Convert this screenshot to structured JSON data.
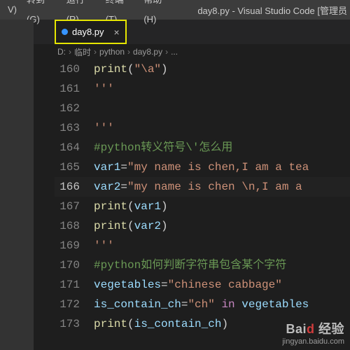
{
  "menu": {
    "items": [
      {
        "label": "V)"
      },
      {
        "label": "转到(G)"
      },
      {
        "label": "运行(R)"
      },
      {
        "label": "终端(T)"
      },
      {
        "label": "帮助(H)"
      }
    ],
    "title": "day8.py - Visual Studio Code [管理员"
  },
  "tab": {
    "dirty_color": "#3794ff",
    "label": "day8.py",
    "close": "×"
  },
  "breadcrumb": {
    "parts": [
      "D:",
      "临时",
      "python",
      "day8.py",
      "..."
    ],
    "chev": "›"
  },
  "dots": "'''",
  "lines": [
    {
      "n": "160",
      "tokens": [
        {
          "t": "fn",
          "v": "print"
        },
        {
          "t": "op",
          "v": "("
        },
        {
          "t": "str",
          "v": "\"\\a\""
        },
        {
          "t": "op",
          "v": ")"
        }
      ]
    },
    {
      "n": "161",
      "tokens": [
        {
          "t": "str",
          "v": "'''"
        }
      ]
    },
    {
      "n": "162",
      "tokens": []
    },
    {
      "n": "163",
      "tokens": [
        {
          "t": "str",
          "v": "'''"
        }
      ]
    },
    {
      "n": "164",
      "tokens": [
        {
          "t": "cmt",
          "v": "#python转义符号\\'怎么用"
        }
      ]
    },
    {
      "n": "165",
      "tokens": [
        {
          "t": "var",
          "v": "var1"
        },
        {
          "t": "op",
          "v": "="
        },
        {
          "t": "str",
          "v": "\"my name is chen,I am a tea"
        }
      ]
    },
    {
      "n": "166",
      "curr": true,
      "tokens": [
        {
          "t": "var",
          "v": "var2"
        },
        {
          "t": "op",
          "v": "="
        },
        {
          "t": "str",
          "v": "\"my name is chen \\n,I am a "
        }
      ]
    },
    {
      "n": "167",
      "tokens": [
        {
          "t": "fn",
          "v": "print"
        },
        {
          "t": "op",
          "v": "("
        },
        {
          "t": "var",
          "v": "var1"
        },
        {
          "t": "op",
          "v": ")"
        }
      ]
    },
    {
      "n": "168",
      "tokens": [
        {
          "t": "fn",
          "v": "print"
        },
        {
          "t": "op",
          "v": "("
        },
        {
          "t": "var",
          "v": "var2"
        },
        {
          "t": "op",
          "v": ")"
        }
      ]
    },
    {
      "n": "169",
      "tokens": [
        {
          "t": "str",
          "v": "'''"
        }
      ]
    },
    {
      "n": "170",
      "tokens": [
        {
          "t": "cmt",
          "v": "#python如何判断字符串包含某个字符"
        }
      ]
    },
    {
      "n": "171",
      "tokens": [
        {
          "t": "var",
          "v": "vegetables"
        },
        {
          "t": "op",
          "v": "="
        },
        {
          "t": "str",
          "v": "\"chinese cabbage\""
        }
      ]
    },
    {
      "n": "172",
      "tokens": [
        {
          "t": "var",
          "v": "is_contain_ch"
        },
        {
          "t": "op",
          "v": "="
        },
        {
          "t": "str",
          "v": "\"ch\""
        },
        {
          "t": "op",
          "v": " "
        },
        {
          "t": "kw",
          "v": "in"
        },
        {
          "t": "op",
          "v": " "
        },
        {
          "t": "var",
          "v": "vegetables"
        }
      ]
    },
    {
      "n": "173",
      "tokens": [
        {
          "t": "fn",
          "v": "print"
        },
        {
          "t": "op",
          "v": "("
        },
        {
          "t": "var",
          "v": "is_contain_ch"
        },
        {
          "t": "op",
          "v": ")"
        }
      ]
    }
  ],
  "watermark": {
    "brand_a": "Bai",
    "brand_b": "d",
    "brand_c": "经验",
    "url": "jingyan.baidu.com"
  }
}
